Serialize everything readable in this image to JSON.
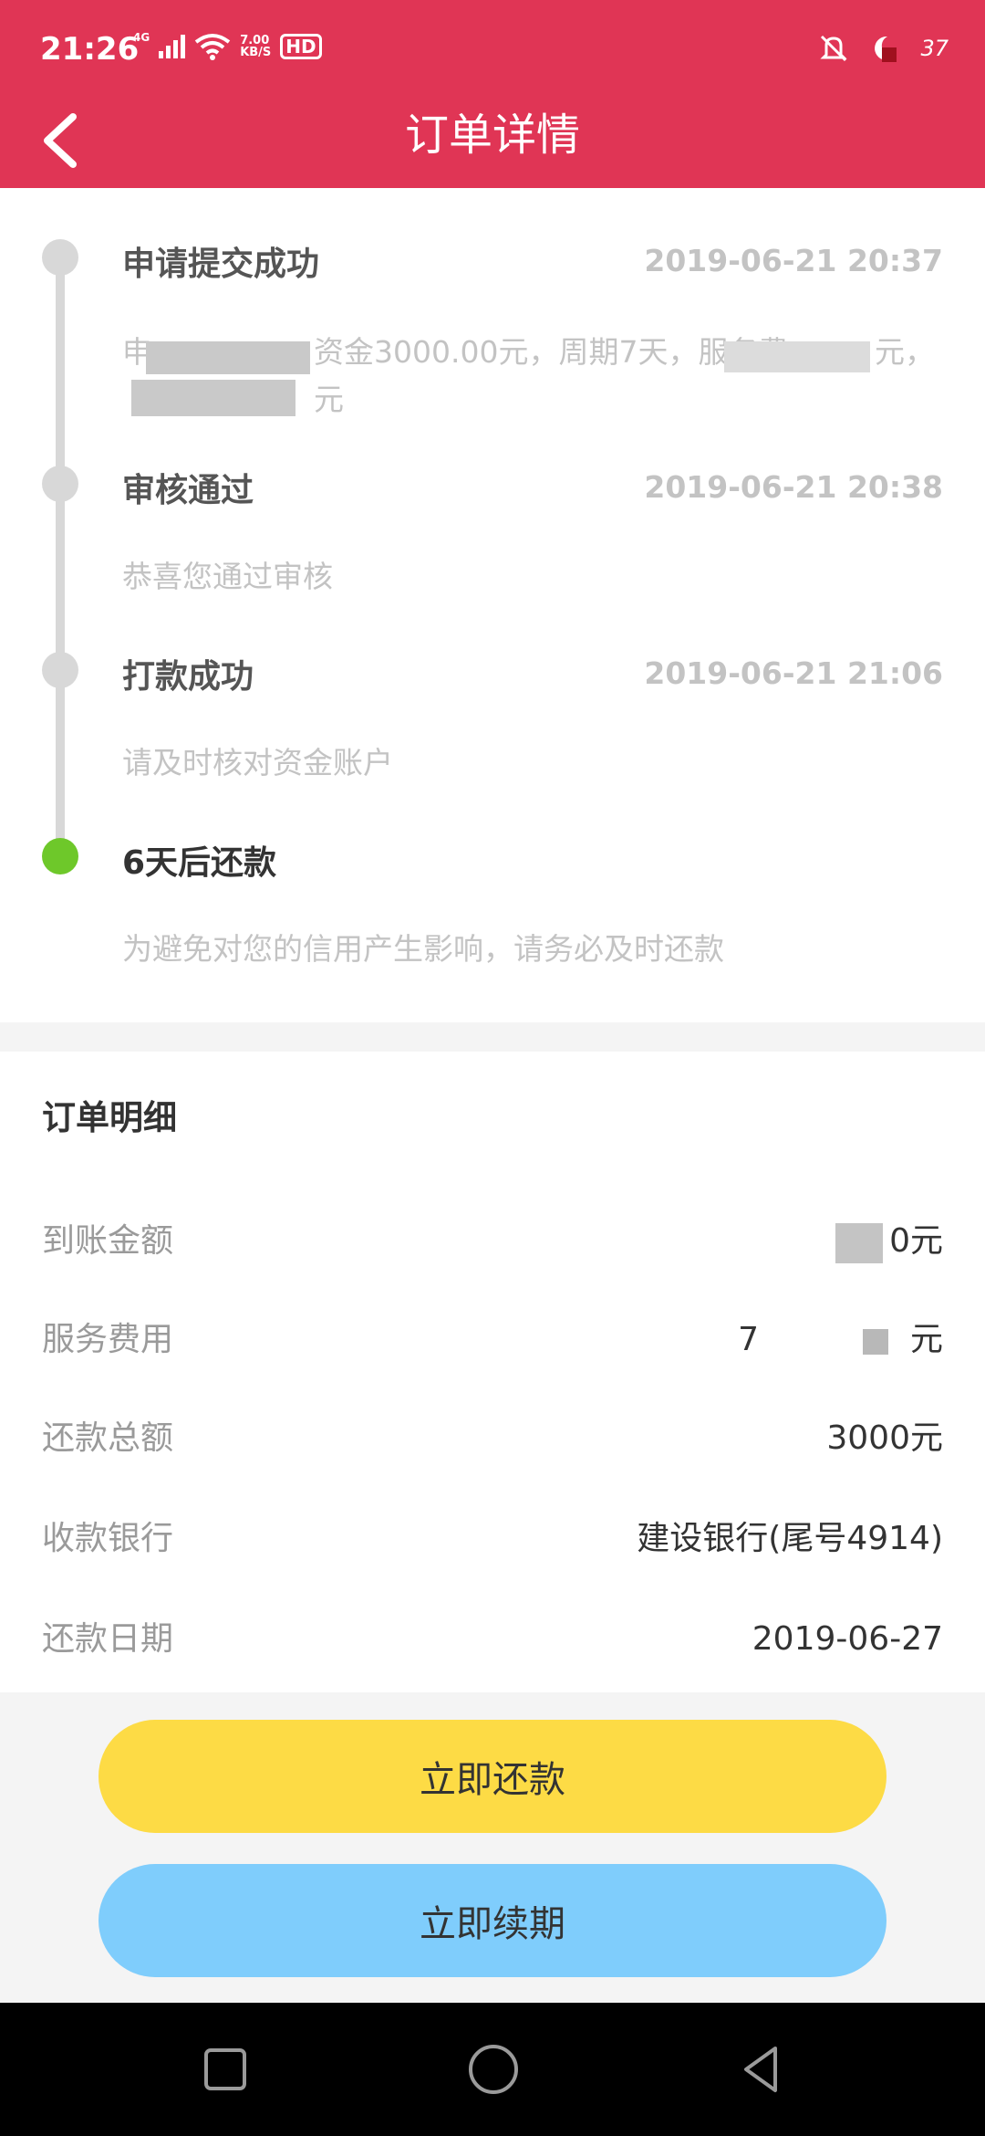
{
  "status_bar": {
    "time": "21:26",
    "network_type": "4G",
    "net_speed_value": "7.00",
    "net_speed_unit": "KB/S",
    "hd_label": "HD",
    "battery_text": "37"
  },
  "header": {
    "title": "订单详情",
    "background_color": "#e03555"
  },
  "timeline": {
    "steps": [
      {
        "title": "申请提交成功",
        "time": "2019-06-21 20:37",
        "desc_line1": "申",
        "desc_line1_b": "资金3000.00元，周期7天，服务费",
        "desc_line1_c": "元，",
        "desc_line2": "元",
        "status": "done"
      },
      {
        "title": "审核通过",
        "time": "2019-06-21 20:38",
        "desc": "恭喜您通过审核",
        "status": "done"
      },
      {
        "title": "打款成功",
        "time": "2019-06-21 21:06",
        "desc": "请及时核对资金账户",
        "status": "done"
      },
      {
        "title": "6天后还款",
        "desc": "为避免对您的信用产生影响，请务必及时还款",
        "status": "current"
      }
    ],
    "active_color": "#6ec82a"
  },
  "detail": {
    "title": "订单明细",
    "rows": [
      {
        "label": "到账金额",
        "value": "0元"
      },
      {
        "label": "服务费用",
        "value_a": "7",
        "value_b": "元"
      },
      {
        "label": "还款总额",
        "value": "3000元"
      },
      {
        "label": "收款银行",
        "value": "建设银行(尾号4914)"
      },
      {
        "label": "还款日期",
        "value": "2019-06-27"
      }
    ]
  },
  "actions": {
    "repay_label": "立即还款",
    "renew_label": "立即续期",
    "repay_color": "#fddb45",
    "renew_color": "#7fcdfc"
  },
  "system_nav": {
    "icons": [
      "square-icon",
      "circle-icon",
      "triangle-back-icon"
    ]
  }
}
